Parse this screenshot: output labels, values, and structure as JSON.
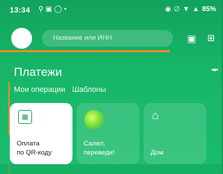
{
  "status_bar": {
    "time": "13:34",
    "left_icons": [
      "search-icon",
      "instagram-icon",
      "circle-icon",
      "dot-icon"
    ],
    "right_icons": [
      "data-saver-icon",
      "signal-off-icon",
      "wifi-icon",
      "cell-signal-icon"
    ],
    "battery": "85%"
  },
  "header": {
    "search_placeholder": "Название или ИНН"
  },
  "payments": {
    "title": "Платежи",
    "tabs": [
      "Мои операции",
      "Шаблоны"
    ],
    "cards": [
      {
        "label_line1": "Оплата",
        "label_line2": "по QR-коду",
        "icon": "qr-scan-icon"
      },
      {
        "label_line1": "Салют,",
        "label_line2": "переведи!",
        "icon": "salut-assistant-icon"
      },
      {
        "label_line1": "",
        "label_line2": "Дом",
        "icon": "home-icon"
      }
    ]
  },
  "colors": {
    "background": "#18b568",
    "accent_annotation": "#f08a2a",
    "card_white": "#ffffff"
  }
}
